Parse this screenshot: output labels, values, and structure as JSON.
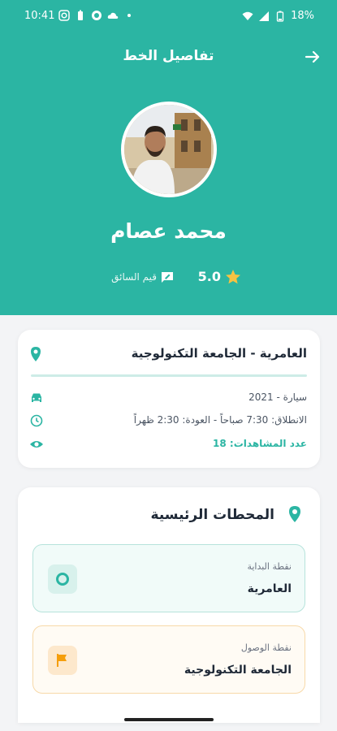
{
  "status_bar": {
    "time": "10:41",
    "battery": "18%"
  },
  "topbar": {
    "title": "تفاصيل الخط",
    "back_icon": "arrow-right-icon"
  },
  "driver": {
    "name": "محمد عصام",
    "rating": "5.0",
    "rate_label": "قيم السائق"
  },
  "route_card": {
    "title": "العامرية - الجامعة التكنولوجية",
    "vehicle": "سيارة - 2021",
    "schedule": "الانطلاق: 7:30 صباحاً - العودة: 2:30 ظهراً",
    "views": "عدد المشاهدات: 18"
  },
  "stations": {
    "title": "المحطات الرئيسية",
    "start_label": "نقطة البداية",
    "start_name": "العامرية",
    "end_label": "نقطة الوصول",
    "end_name": "الجامعة التكنولوجية"
  },
  "colors": {
    "primary": "#2bb5a3",
    "star": "#f6c343",
    "end_accent": "#f59e0b"
  }
}
